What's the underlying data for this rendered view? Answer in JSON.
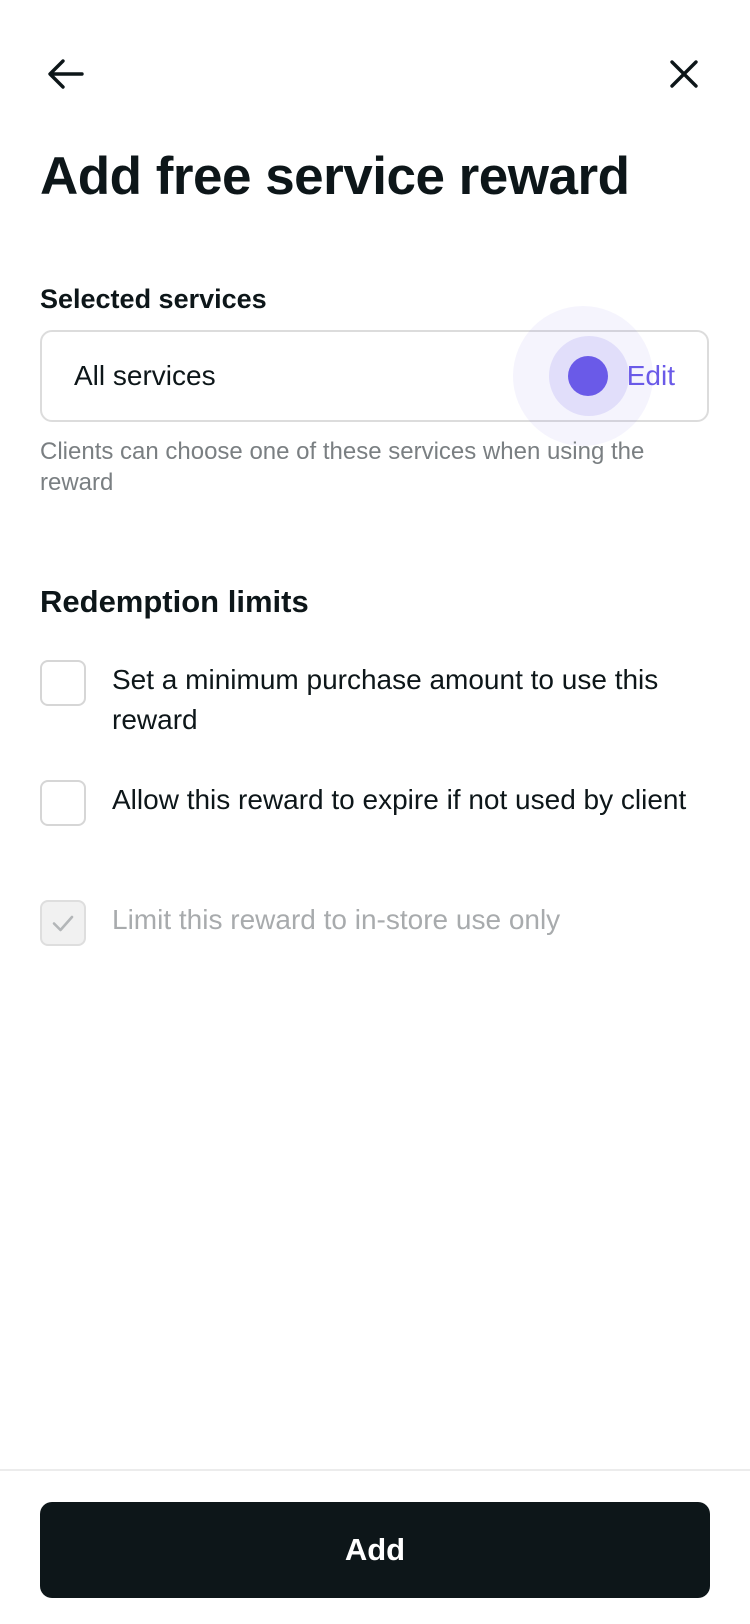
{
  "header": {
    "back_icon": "arrow-left-icon",
    "close_icon": "close-icon",
    "title": "Add free service reward"
  },
  "services": {
    "label": "Selected services",
    "value": "All services",
    "edit_label": "Edit",
    "helper": "Clients can choose one of these services when using the reward"
  },
  "limits": {
    "label": "Redemption limits",
    "options": [
      {
        "label": "Set a minimum purchase amount to use this reward",
        "checked": false,
        "disabled": false
      },
      {
        "label": "Allow this reward to expire if not used by client",
        "checked": false,
        "disabled": false
      },
      {
        "label": "Limit this reward to in-store use only",
        "checked": true,
        "disabled": true
      }
    ]
  },
  "footer": {
    "add_label": "Add"
  },
  "colors": {
    "accent": "#6a5ae8",
    "primary": "#0d1619",
    "muted_text": "#7a7f82",
    "disabled_text": "#a8abad"
  }
}
